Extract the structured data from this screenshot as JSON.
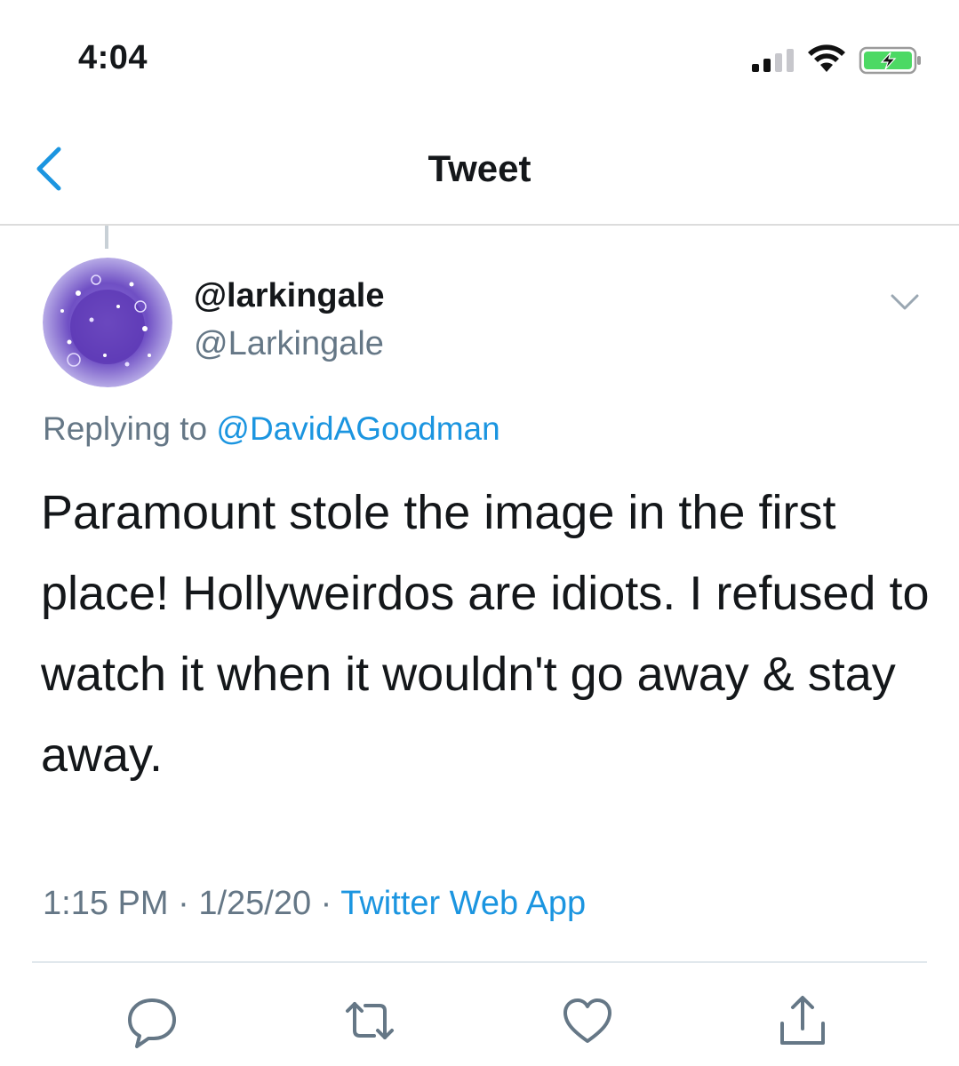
{
  "status_bar": {
    "time": "4:04"
  },
  "nav": {
    "title": "Tweet"
  },
  "tweet": {
    "display_name": "@larkingale",
    "handle": "@Larkingale",
    "replying_prefix": "Replying to ",
    "replying_to": "@DavidAGoodman",
    "text": "Paramount stole the image in the first place! Hollyweirdos are idiots. I refused to watch it when it wouldn't go away & stay away.",
    "time": "1:15 PM",
    "separator": " · ",
    "date": "1/25/20",
    "source": "Twitter Web App"
  },
  "actions": {
    "icons": [
      "reply-icon",
      "retweet-icon",
      "like-icon",
      "share-icon"
    ]
  },
  "colors": {
    "accent": "#1b95e0",
    "secondary_text": "#657786",
    "primary_text": "#14171a",
    "battery_green": "#4cd964"
  }
}
